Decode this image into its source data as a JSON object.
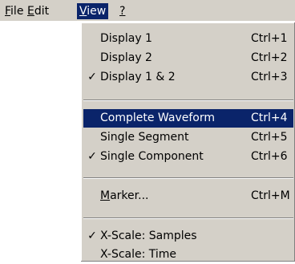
{
  "menubar": {
    "items": [
      {
        "label": "File",
        "mnemonic": "F",
        "rest": "ile"
      },
      {
        "label": "Edit",
        "mnemonic": "E",
        "rest": "dit"
      },
      {
        "label": "View",
        "mnemonic": "V",
        "rest": "iew",
        "active": true
      },
      {
        "label": "?",
        "mnemonic": "?",
        "rest": ""
      }
    ]
  },
  "view_menu": {
    "groups": [
      [
        {
          "label": "Display 1",
          "shortcut": "Ctrl+1",
          "checked": false
        },
        {
          "label": "Display 2",
          "shortcut": "Ctrl+2",
          "checked": false
        },
        {
          "label": "Display 1 & 2",
          "shortcut": "Ctrl+3",
          "checked": true
        }
      ],
      [
        {
          "label": "Complete Waveform",
          "shortcut": "Ctrl+4",
          "checked": false,
          "highlighted": true
        },
        {
          "label": "Single Segment",
          "shortcut": "Ctrl+5",
          "checked": false
        },
        {
          "label": "Single Component",
          "shortcut": "Ctrl+6",
          "checked": true
        }
      ],
      [
        {
          "label": "Marker...",
          "mnemonic": "M",
          "rest": "arker...",
          "shortcut": "Ctrl+M",
          "checked": false
        }
      ],
      [
        {
          "label": "X-Scale: Samples",
          "shortcut": "",
          "checked": true
        },
        {
          "label": "X-Scale: Time",
          "shortcut": "",
          "checked": false
        }
      ]
    ],
    "check_glyph": "✓"
  },
  "colors": {
    "menu_bg": "#d4d0c8",
    "highlight": "#0a246a",
    "highlight_text": "#ffffff"
  }
}
